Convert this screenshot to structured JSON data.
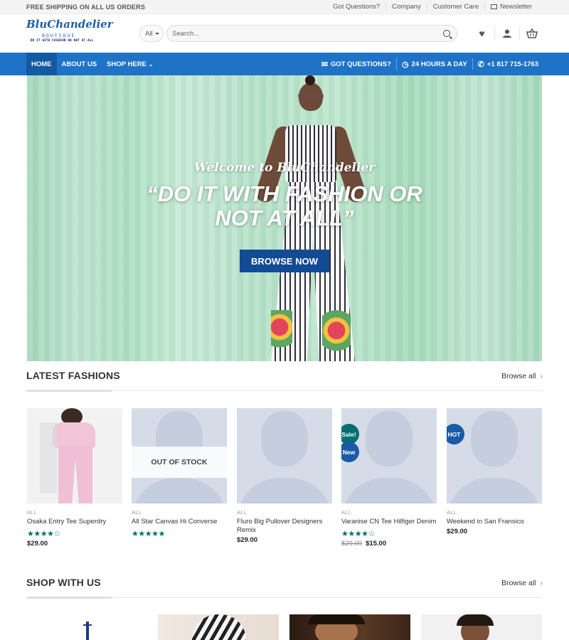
{
  "topbar": {
    "shipping": "FREE SHIPPING ON ALL US ORDERS",
    "links": [
      "Got Questions?",
      "Company",
      "Customer Care",
      "Newsletter"
    ]
  },
  "header": {
    "logo": {
      "script": "BluChandelier",
      "sub": "BOUTIQUE",
      "tagline": "DO IT WITH FASHION OR NOT AT ALL"
    },
    "search": {
      "category": "All",
      "placeholder": "Search..."
    }
  },
  "nav": {
    "items": [
      "HOME",
      "ABOUT US",
      "SHOP HERE"
    ],
    "right": [
      "GOT QUESTIONS?",
      "24 HOURS A DAY",
      "+1 817 715-1763"
    ]
  },
  "hero": {
    "welcome": "Welcome to BluChandelier",
    "quote": "“DO IT WITH FASHION OR NOT AT ALL”",
    "button": "BROWSE NOW"
  },
  "latest": {
    "title": "LATEST FASHIONS",
    "browse_all": "Browse all",
    "products": [
      {
        "category": "ALL",
        "name": "Osaka Entry Tee Superdry",
        "stars": "★★★★☆",
        "price": "$29.00"
      },
      {
        "category": "ALL",
        "name": "All Star Canvas Hi Converse",
        "stars": "★★★★★",
        "overlay": "OUT OF STOCK"
      },
      {
        "category": "ALL",
        "name": "Fluro Big Pullover Designers Remix",
        "price": "$29.00"
      },
      {
        "category": "ALL",
        "name": "Varanise CN Tee Hilfiger Denim",
        "stars": "★★★★☆",
        "old_price": "$29.00",
        "price": "$15.00",
        "badges": [
          "Sale!",
          "New"
        ]
      },
      {
        "category": "ALL",
        "name": "Weekend in San Fransico",
        "price": "$29.00",
        "badges": [
          "HOT"
        ]
      }
    ]
  },
  "shop": {
    "title": "SHOP WITH US",
    "browse_all": "Browse all"
  },
  "colors": {
    "nav": "#1f73c7",
    "button": "#124b94",
    "stars": "#00706f",
    "sale_badge": "#00706f",
    "new_badge": "#1b5aa6"
  }
}
